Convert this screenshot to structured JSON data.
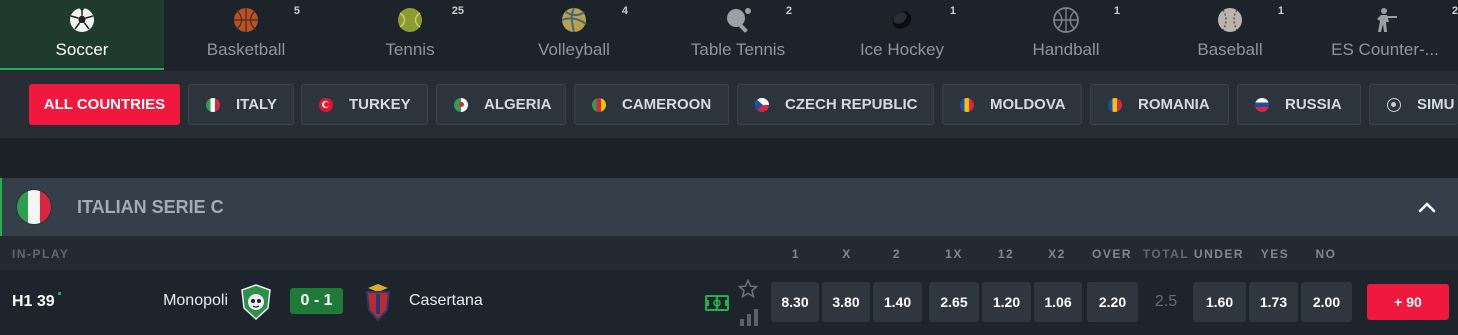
{
  "sports": [
    {
      "name": "Soccer",
      "count": "",
      "icon": "soccer-ball-icon",
      "active": true
    },
    {
      "name": "Basketball",
      "count": "5",
      "icon": "basketball-icon"
    },
    {
      "name": "Tennis",
      "count": "25",
      "icon": "tennis-ball-icon"
    },
    {
      "name": "Volleyball",
      "count": "4",
      "icon": "volleyball-icon"
    },
    {
      "name": "Table Tennis",
      "count": "2",
      "icon": "table-tennis-icon"
    },
    {
      "name": "Ice Hockey",
      "count": "1",
      "icon": "hockey-puck-icon"
    },
    {
      "name": "Handball",
      "count": "1",
      "icon": "handball-icon"
    },
    {
      "name": "Baseball",
      "count": "1",
      "icon": "baseball-icon"
    },
    {
      "name": "ES Counter-...",
      "count": "2",
      "icon": "counter-strike-icon"
    }
  ],
  "countries": {
    "all_label": "ALL COUNTRIES",
    "items": [
      "ITALY",
      "TURKEY",
      "ALGERIA",
      "CAMEROON",
      "CZECH REPUBLIC",
      "MOLDOVA",
      "ROMANIA",
      "RUSSIA",
      "SIMU"
    ]
  },
  "league": {
    "title": "ITALIAN SERIE C"
  },
  "markets": {
    "inplay_label": "IN-PLAY",
    "columns": [
      "1",
      "X",
      "2",
      "1X",
      "12",
      "X2",
      "OVER",
      "TOTAL",
      "UNDER",
      "YES",
      "NO"
    ]
  },
  "event": {
    "time": "H1 39",
    "home": "Monopoli",
    "score": "0 - 1",
    "away": "Casertana",
    "odds": [
      "8.30",
      "3.80",
      "1.40",
      "2.65",
      "1.20",
      "1.06",
      "2.20"
    ],
    "total": "2.5",
    "odds2": [
      "1.60",
      "1.73",
      "2.00"
    ],
    "more": "+ 90"
  },
  "colors": {
    "accent": "#f0183d",
    "live_green": "#22b14c",
    "score_bg": "#1f7a3a"
  }
}
